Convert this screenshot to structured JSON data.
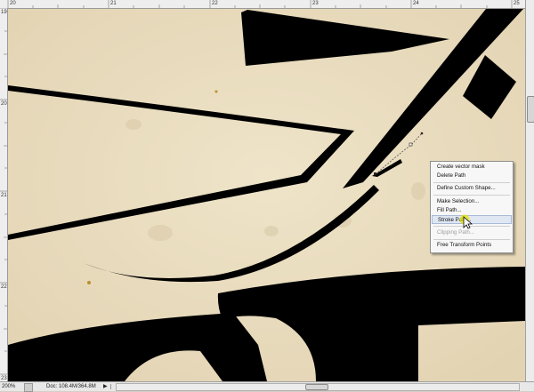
{
  "app": {
    "name": "image editor path context menu"
  },
  "rulers": {
    "top_labels": [
      "20",
      "21",
      "22",
      "23",
      "24",
      "25"
    ],
    "left_labels": [
      "19",
      "20",
      "21",
      "22",
      "23"
    ]
  },
  "context_menu": {
    "items": [
      {
        "label": "Create vector mask",
        "enabled": true
      },
      {
        "label": "Delete Path",
        "enabled": true
      },
      {
        "label": "Define Custom Shape...",
        "enabled": true
      },
      {
        "label": "Make Selection...",
        "enabled": true
      },
      {
        "label": "Fill Path...",
        "enabled": true
      },
      {
        "label": "Stroke Path...",
        "enabled": true,
        "highlighted": true
      },
      {
        "label": "Clipping Path...",
        "enabled": false
      },
      {
        "label": "Free Transform Points",
        "enabled": true
      }
    ]
  },
  "status_bar": {
    "zoom": "200%",
    "doc": "Doc: 108.4M/364.8M",
    "arrow": "▶"
  },
  "colors": {
    "paper": "#e9dcbf",
    "ink": "#000000",
    "menu_highlight": "#dfe7f3",
    "cursor_highlight": "#e6e600"
  },
  "icons": {
    "cursor": "arrow-pointer-icon",
    "status_arrow": "triangle-right-icon"
  }
}
